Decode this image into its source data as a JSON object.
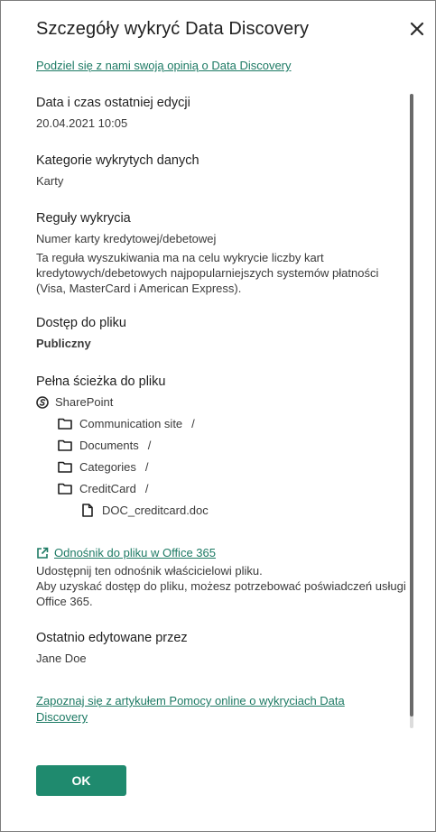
{
  "dialog": {
    "title": "Szczegóły wykryć Data Discovery",
    "feedback_link": "Podziel się z nami swoją opinią o Data Discovery"
  },
  "sections": {
    "last_edit": {
      "heading": "Data i czas ostatniej edycji",
      "value": "20.04.2021 10:05"
    },
    "categories": {
      "heading": "Kategorie wykrytych danych",
      "value": "Karty"
    },
    "rules": {
      "heading": "Reguły wykrycia",
      "rule_name": "Numer karty kredytowej/debetowej",
      "rule_desc": "Ta reguła wyszukiwania ma na celu wykrycie liczby kart kredytowych/debetowych najpopularniejszych systemów płatności (Visa, MasterCard i American Express)."
    },
    "access": {
      "heading": "Dostęp do pliku",
      "value": "Publiczny"
    },
    "path": {
      "heading": "Pełna ścieżka do pliku",
      "root": "SharePoint",
      "folders": [
        "Communication site",
        "Documents",
        "Categories",
        "CreditCard"
      ],
      "separator": "/",
      "file": "DOC_creditcard.doc"
    },
    "office_link": {
      "link_text": "Odnośnik do pliku w Office 365",
      "note_line1": "Udostępnij ten odnośnik właścicielowi pliku.",
      "note_line2": "Aby uzyskać dostęp do pliku, możesz potrzebować poświadczeń usługi Office 365."
    },
    "edited_by": {
      "heading": "Ostatnio edytowane przez",
      "value": "Jane Doe"
    },
    "help_link": "Zapoznaj się z artykułem Pomocy online o wykryciach Data Discovery"
  },
  "footer": {
    "ok_label": "OK"
  },
  "colors": {
    "accent": "#1f8a6e",
    "link": "#1d7a64"
  },
  "icons": {
    "close": "close-icon",
    "sharepoint": "sharepoint-icon",
    "folder": "folder-icon",
    "file": "file-icon",
    "external_link": "external-link-icon"
  }
}
